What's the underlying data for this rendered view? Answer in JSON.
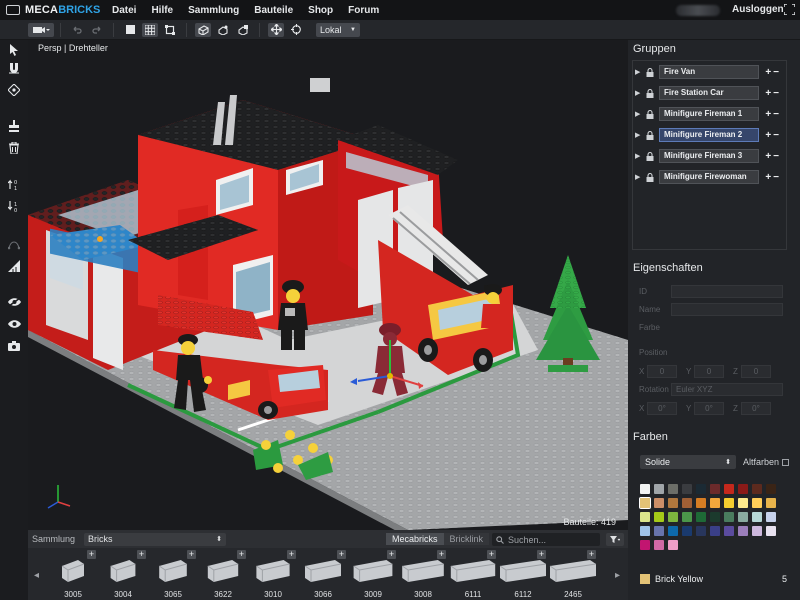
{
  "app": {
    "logo_part1": "MECA",
    "logo_part2": "BRICKS",
    "menu": [
      "Datei",
      "Hilfe",
      "Sammlung",
      "Bauteile",
      "Shop",
      "Forum"
    ],
    "logout": "Ausloggen"
  },
  "toolbar": {
    "space_mode": "Lokal"
  },
  "viewport": {
    "label": "Persp | Drehteller",
    "part_count": "Bauteile: 419"
  },
  "palette": {
    "sammlung_label": "Sammlung",
    "category": "Bricks",
    "tab_mecabricks": "Mecabricks",
    "tab_bricklink": "Bricklink",
    "search_placeholder": "Suchen...",
    "items": [
      "3005",
      "3004",
      "3065",
      "3622",
      "3010",
      "3066",
      "3009",
      "3008",
      "6111",
      "6112",
      "2465"
    ]
  },
  "right_panel": {
    "groups_title": "Gruppen",
    "groups": [
      {
        "name": "Fire Van",
        "selected": false
      },
      {
        "name": "Fire Station Car",
        "selected": false
      },
      {
        "name": "Minifigure Fireman 1",
        "selected": false
      },
      {
        "name": "Minifigure Fireman 2",
        "selected": true
      },
      {
        "name": "Minifigure Fireman 3",
        "selected": false
      },
      {
        "name": "Minifigure Firewoman",
        "selected": false
      }
    ],
    "properties_title": "Eigenschaften",
    "properties": {
      "id_label": "ID",
      "name_label": "Name",
      "color_label": "Farbe",
      "position_label": "Position",
      "pos_x_label": "X",
      "pos_x": "0",
      "pos_y_label": "Y",
      "pos_y": "0",
      "pos_z_label": "Z",
      "pos_z": "0",
      "rotation_label": "Rotation",
      "rotation_mode": "Euler XYZ",
      "rot_x_label": "X",
      "rot_x": "0°",
      "rot_y_label": "Y",
      "rot_y": "0°",
      "rot_z_label": "Z",
      "rot_z": "0°"
    },
    "colors_title": "Farben",
    "color_type": "Solide",
    "alt_colors_label": "Altfarben",
    "selected_color": "Brick Yellow",
    "selected_count": "5",
    "swatch_colors": [
      [
        "#f2f3f2",
        "#a0a5a9",
        "#6c6e68",
        "#3a3c40",
        "#1b2a34",
        "#6b2a2b",
        "#c4281c",
        "#8a1a18",
        "#5c2a1e",
        "#3a2416"
      ],
      [
        "#e3c276",
        "#cc8e68",
        "#b0773d",
        "#a05f35",
        "#d67d23",
        "#f1a73c",
        "#f5cd2f",
        "#fdea8c",
        "#ffcd59",
        "#e7b34b"
      ],
      [
        "#dbe58c",
        "#a5ca18",
        "#7db53e",
        "#4b974a",
        "#1e6a36",
        "#1b3a2d",
        "#4a7c5e",
        "#8aaba0",
        "#b6d7d6",
        "#c7d2ec"
      ],
      [
        "#9fc3e9",
        "#6874ac",
        "#0d69ab",
        "#1a3a6e",
        "#28365d",
        "#3a3f88",
        "#5b4b9e",
        "#9b7eba",
        "#cdb8dd",
        "#e8e1ef"
      ],
      [
        "#c21570",
        "#d069a5",
        "#ef9ec8",
        "#ffffff",
        "#ffffff",
        "#ffffff",
        "#ffffff",
        "#ffffff",
        "#ffffff",
        "#ffffff"
      ]
    ]
  }
}
